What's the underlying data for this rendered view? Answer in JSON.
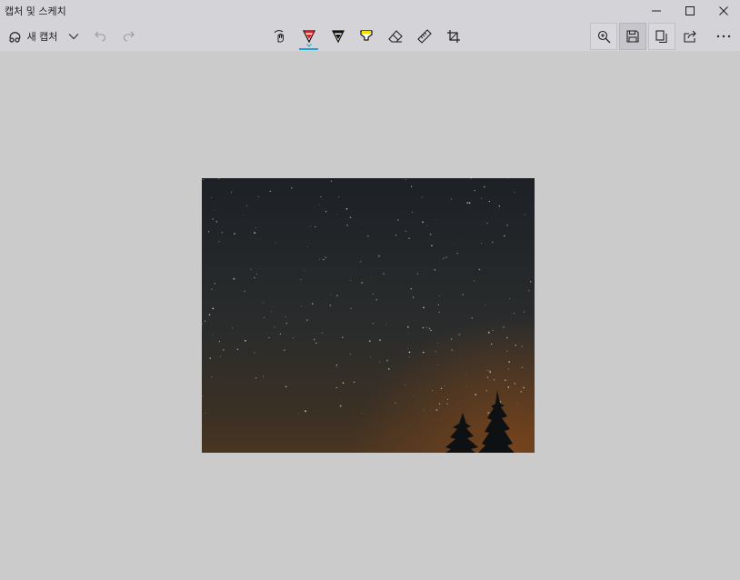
{
  "window": {
    "title": "캡처 및 스케치",
    "controls": [
      "minimize",
      "maximize",
      "close"
    ]
  },
  "toolbar": {
    "new_capture_label": "새 캡처",
    "left_actions": [
      "new-capture-dropdown",
      "undo",
      "redo"
    ],
    "tools": [
      "touch-writing",
      "ballpoint-pen",
      "pencil",
      "highlighter",
      "eraser",
      "ruler",
      "image-crop"
    ],
    "active_tool": "ballpoint-pen",
    "right_actions": [
      "zoom",
      "save-as",
      "copy",
      "share",
      "see-more"
    ],
    "colors": {
      "active_underline": "#1aa3d9",
      "pen_ink": "#e02020",
      "pencil_ink": "#111111",
      "highlighter_ink": "#f2e000"
    }
  },
  "image": {
    "description_icon": "night-sky-photo",
    "sky_colors": [
      "#1d2126",
      "#2a2c2c",
      "#4a3522",
      "#6b3f1c"
    ]
  }
}
